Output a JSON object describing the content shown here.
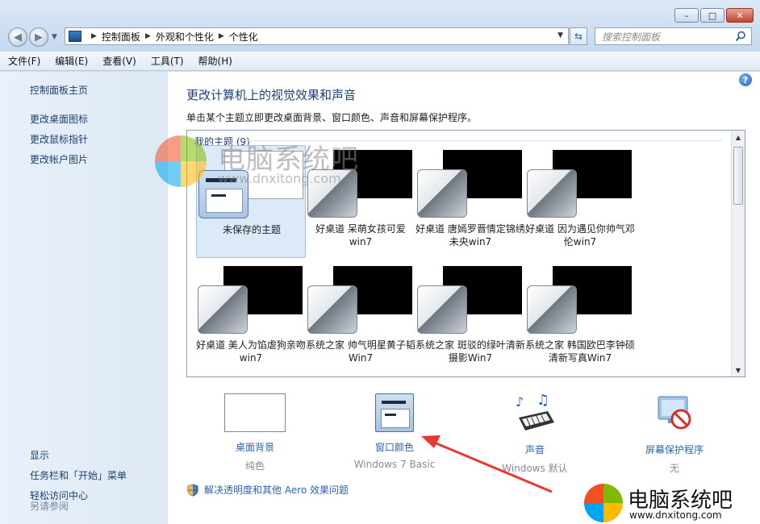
{
  "titlebar": {
    "minimize": "–",
    "maximize": "□",
    "close": "✕"
  },
  "address": {
    "crumbs": [
      "控制面板",
      "外观和个性化",
      "个性化"
    ]
  },
  "search": {
    "placeholder": "搜索控制面板"
  },
  "menu": [
    "文件(F)",
    "编辑(E)",
    "查看(V)",
    "工具(T)",
    "帮助(H)"
  ],
  "sidebar": {
    "links": [
      "控制面板主页",
      "更改桌面图标",
      "更改鼠标指针",
      "更改帐户图片"
    ],
    "see_also_title": "另请参阅",
    "see_also": [
      "显示",
      "任务栏和「开始」菜单",
      "轻松访问中心"
    ]
  },
  "main": {
    "title": "更改计算机上的视觉效果和声音",
    "description": "单击某个主题立即更改桌面背景、窗口颜色、声音和屏幕保护程序。",
    "group_label": "我的主题 (9)",
    "themes": [
      {
        "name": "未保存的主题",
        "selected": true
      },
      {
        "name": "好桌道 呆萌女孩可爱win7"
      },
      {
        "name": "好桌道 唐嫣罗晋情定锦绣未央win7"
      },
      {
        "name": "好桌道 因为遇见你帅气邓伦win7"
      },
      {
        "name": "好桌道 美人为馅虐狗亲吻win7"
      },
      {
        "name": "系统之家 帅气明星黄子韬Win7"
      },
      {
        "name": "系统之家 斑驳的绿叶清新摄影Win7"
      },
      {
        "name": "系统之家 韩国欧巴李钟硕清新写真Win7"
      }
    ],
    "bottom": [
      {
        "label": "桌面背景",
        "sub": "纯色"
      },
      {
        "label": "窗口颜色",
        "sub": "Windows 7 Basic"
      },
      {
        "label": "声音",
        "sub": "Windows 默认"
      },
      {
        "label": "屏幕保护程序",
        "sub": "无"
      }
    ],
    "fix_link": "解决透明度和其他 Aero 效果问题"
  },
  "watermark": {
    "name": "电脑系统吧",
    "url": "www.dnxitong.com"
  },
  "colors": {
    "accent": "#2b64b7",
    "title": "#1e3f7b",
    "arrow": "#e53935"
  }
}
